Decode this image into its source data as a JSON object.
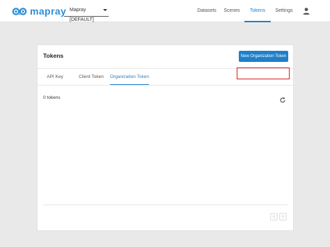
{
  "header": {
    "logo_text": "mapray",
    "org_selector": {
      "value": "Mapray [DEFAULT]"
    },
    "nav": [
      {
        "label": "Datasets",
        "active": false
      },
      {
        "label": "Scenes",
        "active": false
      },
      {
        "label": "Tokens",
        "active": true
      },
      {
        "label": "Settings",
        "active": false
      }
    ],
    "user_icon": "account-icon"
  },
  "card": {
    "title": "Tokens",
    "new_token_button": "New Organization Token",
    "tabs": [
      {
        "label": "API Key",
        "active": false
      },
      {
        "label": "Client Token",
        "active": false
      },
      {
        "label": "Organization Token",
        "active": true
      }
    ],
    "count_text": "0 tokens",
    "refresh_icon": "refresh-icon",
    "pager": {
      "prev_icon": "chevron-left-icon",
      "next_icon": "chevron-right-icon",
      "prev": "‹",
      "next": "›"
    }
  },
  "colors": {
    "accent": "#1f7fc9",
    "logo": "#2c8fd6",
    "highlight": "#e01818",
    "background": "#e9e9e9"
  }
}
